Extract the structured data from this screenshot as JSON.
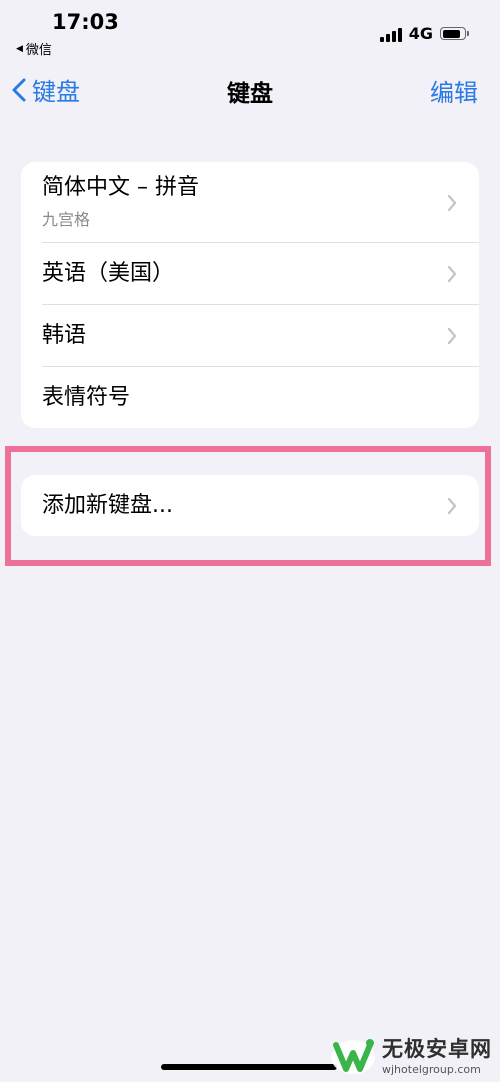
{
  "status_bar": {
    "time": "17:03",
    "back_app": "微信",
    "network": "4G",
    "battery_level": 0.85
  },
  "nav": {
    "back_label": "键盘",
    "title": "键盘",
    "edit_label": "编辑"
  },
  "keyboards": [
    {
      "label": "简体中文 – 拼音",
      "subtitle": "九宫格"
    },
    {
      "label": "英语（美国）"
    },
    {
      "label": "韩语"
    },
    {
      "label": "表情符号"
    }
  ],
  "add_keyboard": {
    "label": "添加新键盘..."
  },
  "watermark": {
    "main": "无极安卓网",
    "url": "wjhotelgroup.com"
  },
  "colors": {
    "accent": "#2a7ae4",
    "highlight": "#ee7197",
    "background": "#f2f1f7"
  }
}
